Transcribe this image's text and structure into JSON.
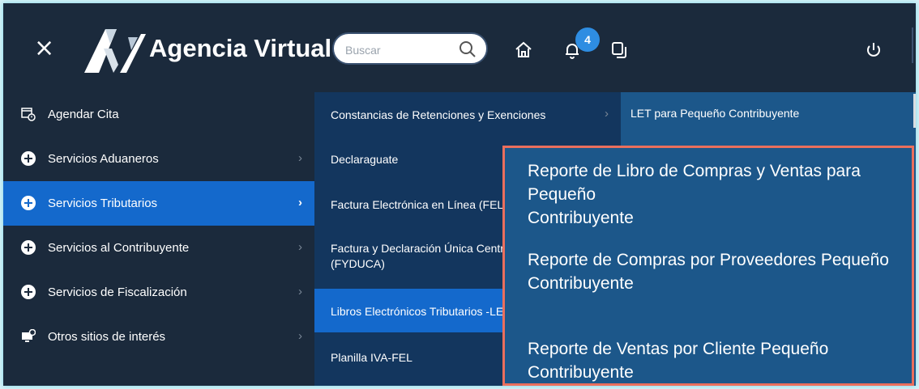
{
  "header": {
    "title": "Agencia Virtual",
    "search_placeholder": "Buscar",
    "notification_count": "4"
  },
  "menu1": [
    {
      "label": "Agendar Cita",
      "icon": "calendar-clock-icon"
    },
    {
      "label": "Servicios Aduaneros",
      "icon": "plus-circle-icon"
    },
    {
      "label": "Servicios Tributarios",
      "icon": "plus-circle-icon",
      "active": true
    },
    {
      "label": "Servicios al Contribuyente",
      "icon": "plus-circle-icon"
    },
    {
      "label": "Servicios de Fiscalización",
      "icon": "plus-circle-icon"
    },
    {
      "label": "Otros sitios de interés",
      "icon": "monitor-gear-icon"
    }
  ],
  "menu2": [
    {
      "label": "Constancias de Retenciones y Exenciones"
    },
    {
      "label": "Declaraguate"
    },
    {
      "label": "Factura Electrónica en Línea (FEL)"
    },
    {
      "label_line1": "Factura y Declaración Única Centro",
      "label_line2": "(FYDUCA)"
    },
    {
      "label": "Libros Electrónicos Tributarios -LET"
    },
    {
      "label": "Planilla IVA-FEL"
    }
  ],
  "menu3": [
    {
      "label": "LET para Pequeño Contribuyente"
    }
  ],
  "popup": [
    {
      "line1": "Reporte de Libro de Compras y Ventas para Pequeño",
      "line2": "Contribuyente"
    },
    {
      "line1": "Reporte de Compras por Proveedores Pequeño",
      "line2": "Contribuyente"
    },
    {
      "line1": "Reporte de Ventas por Cliente Pequeño",
      "line2": "Contribuyente"
    }
  ],
  "colors": {
    "navy": "#1b2a3c",
    "active_blue": "#1469cc",
    "submenu_bg": "#13365e",
    "panel_bg": "#1c578a",
    "highlight_border": "#ea6f5d",
    "badge": "#2e8de2"
  }
}
